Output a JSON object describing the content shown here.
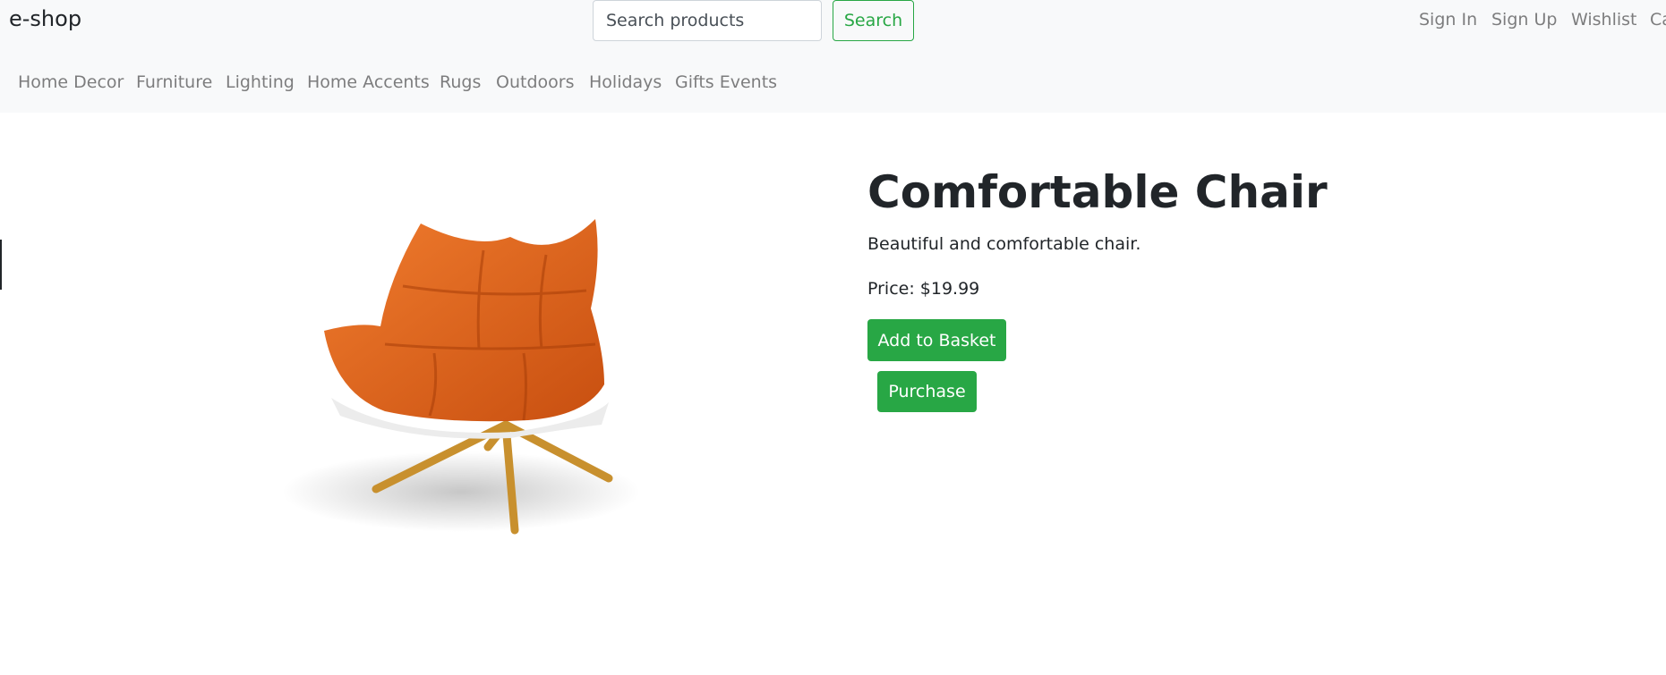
{
  "header": {
    "brand": "e-shop",
    "search": {
      "placeholder": "Search products",
      "button_label": "Search"
    },
    "account_links": [
      "Sign In",
      "Sign Up",
      "Wishlist",
      "Ca"
    ]
  },
  "categories": [
    "Home Decor",
    "Furniture",
    "Lighting",
    "Home Accents",
    "Rugs",
    "Outdoors",
    "Holidays",
    "Gifts Events"
  ],
  "product": {
    "image_icon": "orange-lounge-chair",
    "title": "Comfortable Chair",
    "description": "Beautiful and comfortable chair.",
    "price_text": "Price: $19.99",
    "add_button_label": "Add to Basket",
    "purchase_button_label": "Purchase"
  },
  "colors": {
    "accent": "#28a745",
    "navbar_bg": "#f8f9fa",
    "chair": "#e0641c"
  }
}
